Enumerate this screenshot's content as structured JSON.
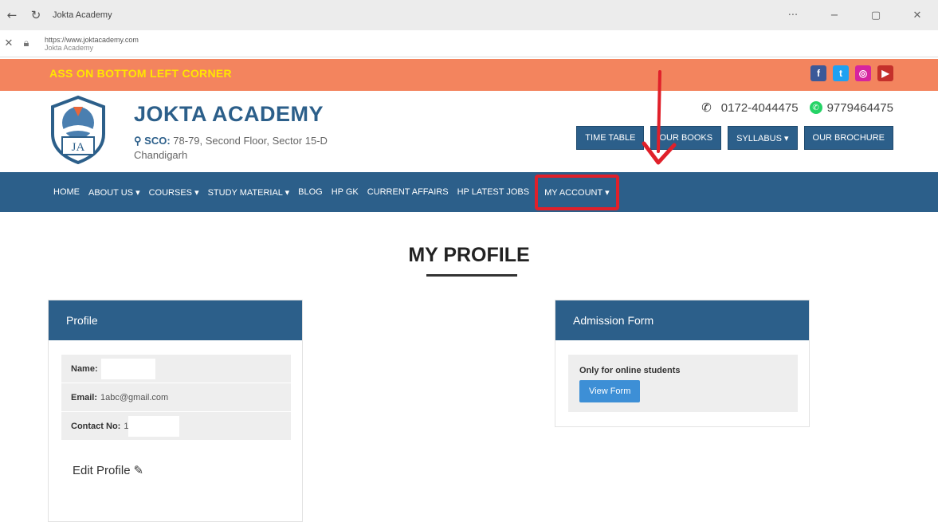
{
  "browser": {
    "back_icon": "back-arrow-icon",
    "refresh_icon": "refresh-icon",
    "tab_title": "Jokta Academy",
    "more": "···",
    "minimize": "−",
    "maximize": "▢",
    "close": "✕",
    "url": "https://www.joktacademy.com",
    "site_name": "Jokta Academy"
  },
  "topbar": {
    "marquee": "ASS ON BOTTOM LEFT CORNER",
    "social": [
      {
        "name": "facebook",
        "glyph": "f",
        "color": "#3b5998"
      },
      {
        "name": "twitter",
        "glyph": "t",
        "color": "#1da1f2"
      },
      {
        "name": "instagram",
        "glyph": "◎",
        "color": "#d6249f"
      },
      {
        "name": "youtube",
        "glyph": "▶",
        "color": "#c4302b"
      }
    ]
  },
  "header": {
    "brand": "JOKTA ACADEMY",
    "logo_letters": "JA",
    "address_label": "SCO:",
    "address_line1": "78-79, Second Floor, Sector 15-D",
    "address_line2": "Chandigarh",
    "phone1": "0172-4044475",
    "phone2": "9779464475",
    "buttons": {
      "time_table": "TIME TABLE",
      "our_books": "OUR BOOKS",
      "syllabus": "SYLLABUS ▾",
      "our_brochure": "OUR BROCHURE"
    }
  },
  "nav": {
    "home": "HOME",
    "about": "ABOUT US ▾",
    "courses": "COURSES ▾",
    "study": "STUDY MATERIAL ▾",
    "blog": "BLOG",
    "hpgk": "HP GK",
    "current": "CURRENT AFFAIRS",
    "jobs": "HP LATEST JOBS",
    "account": "MY ACCOUNT ▾"
  },
  "main": {
    "title": "MY PROFILE",
    "profile": {
      "heading": "Profile",
      "name_label": "Name:",
      "email_label": "Email:",
      "email_value": "1abc@gmail.com",
      "contact_label": "Contact No:",
      "contact_value": "1",
      "edit": "Edit Profile"
    },
    "admission": {
      "heading": "Admission Form",
      "note": "Only for online students",
      "button": "View Form"
    }
  },
  "colors": {
    "primary": "#2c5f8a",
    "topbar": "#f3845e",
    "marquee": "#ffe600",
    "annotation": "#e0202a",
    "button_blue": "#3d8fd6"
  }
}
